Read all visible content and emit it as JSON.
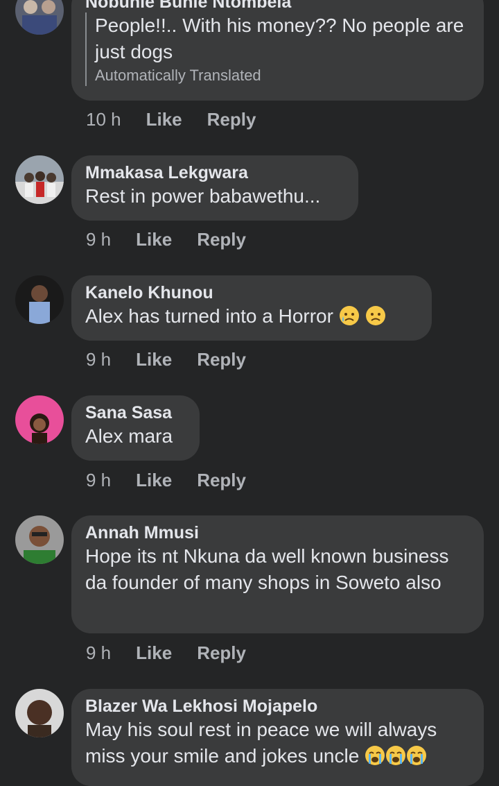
{
  "comments": [
    {
      "name": "Nobuhle Buhle Ntombela",
      "text": "People!!.. With his money?? No people are just dogs",
      "note": "Automatically Translated",
      "time": "10 h",
      "like": "Like",
      "reply": "Reply"
    },
    {
      "name": "Mmakasa Lekgwara",
      "text": "Rest in power babawethu...",
      "time": "9 h",
      "like": "Like",
      "reply": "Reply"
    },
    {
      "name": "Kanelo Khunou",
      "text": "Alex has turned into a Horror",
      "emojis": [
        "sad-tear-emoji",
        "frown-emoji"
      ],
      "time": "9 h",
      "like": "Like",
      "reply": "Reply"
    },
    {
      "name": "Sana Sasa",
      "text": "Alex mara",
      "time": "9 h",
      "like": "Like",
      "reply": "Reply"
    },
    {
      "name": "Annah Mmusi",
      "text": "Hope its nt Nkuna da well known business da founder of many shops in Soweto also",
      "time": "9 h",
      "like": "Like",
      "reply": "Reply"
    },
    {
      "name": "Blazer Wa Lekhosi Mojapelo",
      "text": "May his soul rest in peace we will always miss your smile and jokes uncle",
      "emojis": [
        "crying-emoji",
        "crying-emoji",
        "crying-emoji"
      ]
    }
  ],
  "colors": {
    "background": "#242526",
    "bubble": "#3a3b3c",
    "text": "#e4e6eb",
    "secondary": "#b0b3b8"
  }
}
